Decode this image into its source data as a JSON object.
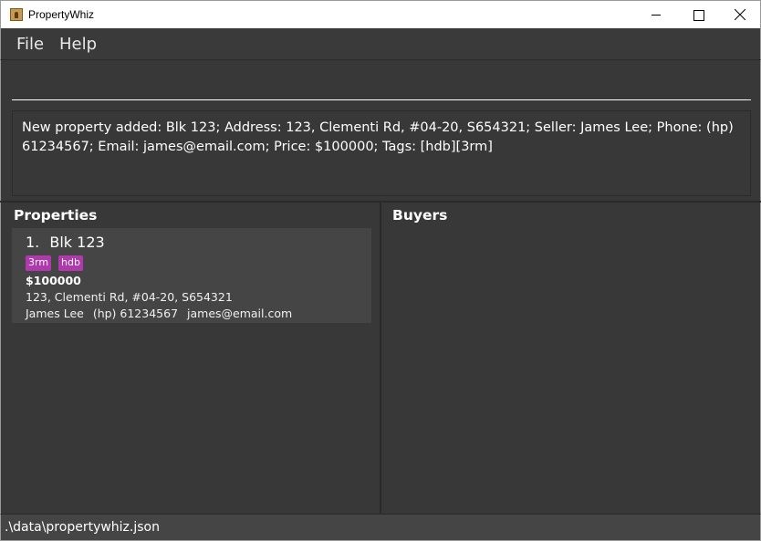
{
  "window": {
    "title": "PropertyWhiz"
  },
  "menu": {
    "file": "File",
    "help": "Help"
  },
  "command": {
    "value": "",
    "placeholder": ""
  },
  "result": {
    "message": "New property added: Blk 123; Address: 123, Clementi Rd, #04-20, S654321; Seller: James Lee; Phone: (hp) 61234567; Email: james@email.com; Price: $100000; Tags: [hdb][3rm]"
  },
  "properties": {
    "title": "Properties",
    "items": [
      {
        "index": "1.",
        "name": "Blk 123",
        "tags": [
          "3rm",
          "hdb"
        ],
        "price": "$100000",
        "address": "123, Clementi Rd, #04-20, S654321",
        "seller": "James Lee",
        "phone": "(hp) 61234567",
        "email": "james@email.com"
      }
    ]
  },
  "buyers": {
    "title": "Buyers",
    "items": []
  },
  "status": {
    "path": ".\\data\\propertywhiz.json"
  },
  "colors": {
    "background": "#383838",
    "card": "#454545",
    "tag": "#b03aad"
  }
}
